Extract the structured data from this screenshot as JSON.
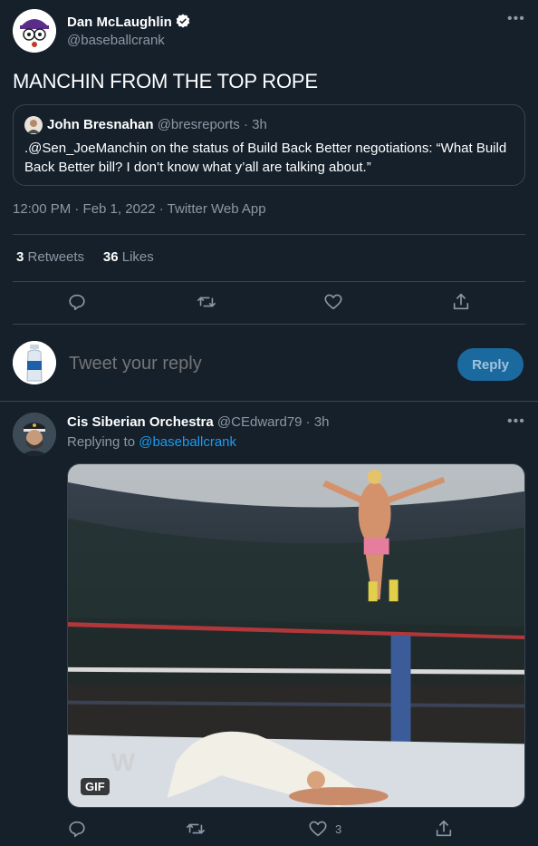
{
  "main_tweet": {
    "author_name": "Dan McLaughlin",
    "author_handle": "@baseballcrank",
    "verified_icon": "verified-badge-icon",
    "text": "MANCHIN FROM THE TOP ROPE",
    "quote": {
      "author_name": "John Bresnahan",
      "author_meta": "@bresreports · 3h",
      "text": ".@Sen_JoeManchin on the status of Build Back Better negotiations: “What Build Back Better bill? I don’t know what y’all are talking about.”"
    },
    "timestamp": "12:00 PM · Feb 1, 2022 · Twitter Web App",
    "retweets_count": "3",
    "retweets_label": "Retweets",
    "likes_count": "36",
    "likes_label": "Likes",
    "actions": [
      "reply-icon",
      "retweet-icon",
      "like-icon",
      "share-icon"
    ]
  },
  "composer": {
    "placeholder": "Tweet your reply",
    "button_label": "Reply"
  },
  "reply_tweet": {
    "author_name": "Cis Siberian Orchestra",
    "author_meta": "@CEdward79 · 3h",
    "replying_prefix": "Replying to",
    "replying_handle": "@baseballcrank",
    "gif_badge": "GIF",
    "like_count": "3"
  },
  "colors": {
    "background": "#15202b",
    "border": "#38444d",
    "secondary_text": "#8b98a5",
    "accent": "#1d9bf0"
  }
}
